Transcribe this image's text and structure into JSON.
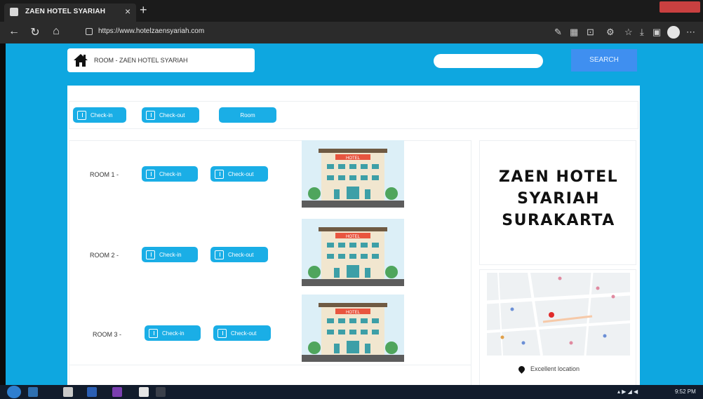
{
  "browser": {
    "tab_title": "ZAEN HOTEL SYARIAH",
    "url": "https://www.hotelzaensyariah.com"
  },
  "header": {
    "brand_text": "ROOM - ZAEN HOTEL SYARIAH",
    "search_placeholder": "",
    "search_label": "SEARCH"
  },
  "top_buttons": {
    "checkin_label": "Check-in",
    "checkout_label": "Check-out",
    "room_label": "Room"
  },
  "rooms": [
    {
      "label": "ROOM 1 -",
      "checkin": "Check-in",
      "checkout": "Check-out",
      "image_sign": "HOTEL"
    },
    {
      "label": "ROOM 2 -",
      "checkin": "Check-in",
      "checkout": "Check-out",
      "image_sign": "HOTEL"
    },
    {
      "label": "ROOM 3 -",
      "checkin": "Check-in",
      "checkout": "Check-out",
      "image_sign": "HOTEL"
    }
  ],
  "sidebar": {
    "title_line1": "ZAEN HOTEL",
    "title_line2": "SYARIAH",
    "title_line3": "SURAKARTA",
    "location_text": "Excellent location"
  },
  "taskbar": {
    "time": "9:52 PM"
  },
  "colors": {
    "page_bg": "#0ea7e0",
    "button": "#1aaee6",
    "search_button": "#3f8ff0"
  }
}
